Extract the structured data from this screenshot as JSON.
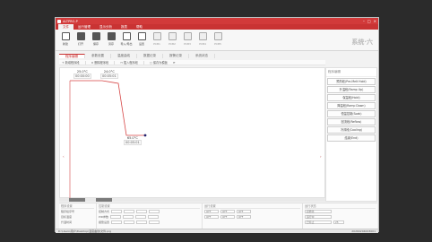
{
  "window": {
    "title": "ALTPRO-P"
  },
  "menu": [
    "文件",
    "运行管理",
    "显示分析",
    "报表",
    "帮助"
  ],
  "ribbon": {
    "buttons": [
      {
        "label": "新建",
        "icon": "new-file-icon"
      },
      {
        "label": "打开",
        "icon": "open-folder-icon"
      },
      {
        "label": "保存",
        "icon": "save-icon"
      },
      {
        "label": "另存",
        "icon": "save-as-icon"
      },
      {
        "label": "导入/导出",
        "icon": "import-export-icon"
      },
      {
        "label": "设置",
        "icon": "settings-icon"
      },
      {
        "label": "PCB1",
        "icon": "pcb-icon"
      },
      {
        "label": "PCB2",
        "icon": "pcb-icon"
      },
      {
        "label": "PCB3",
        "icon": "pcb-icon"
      },
      {
        "label": "PCB4",
        "icon": "pcb-icon"
      },
      {
        "label": "PCB5",
        "icon": "pcb-icon"
      }
    ],
    "brand": "系统·六"
  },
  "tabs": [
    "程序编辑",
    "参数设置",
    "温度曲线",
    "数据记录",
    "报警记录",
    "系统状态"
  ],
  "toolbar": [
    "+ 新增程序段",
    "× 删除程序段",
    "↔ 插入程序段",
    "▢ 保存为模板"
  ],
  "plot": {
    "segments": [
      {
        "temp": "25.0°C",
        "time": "00:00:00"
      },
      {
        "temp": "24.0°C",
        "time": "00:05:01"
      },
      {
        "temp": "65.0°C",
        "time": "00:05:01"
      }
    ]
  },
  "side": {
    "header": "程序编辑",
    "items": [
      "预热段(Pre-Melt Hold)",
      "升温段(Ramp Up)",
      "保温段(Hold)",
      "降温段(Ramp Down)",
      "恒温控制(Soak)",
      "回流段(Reflow)",
      "冷却段(Cooling)",
      "结束(End)"
    ]
  },
  "bottom": {
    "p1": {
      "header": "程序设置",
      "rows": [
        "程序段序号",
        "目标温度",
        "升温时间"
      ]
    },
    "p2": {
      "header": "控制设置",
      "rows": [
        "控制方式",
        "PID参数",
        "报警设置"
      ]
    },
    "p3": {
      "header": "运行设置",
      "cells": [
        "OFF",
        "OFF",
        "OFF",
        "OFF",
        "OFF",
        "OFF"
      ]
    },
    "p4": {
      "header": "运行状态",
      "values": [
        "初始化",
        "运行中",
        "已停止",
        "25"
      ]
    }
  },
  "status": {
    "left": "D:\\Users\\用户\\Desktop\\温度曲线\\文件.prg",
    "right": "20260204003001"
  }
}
